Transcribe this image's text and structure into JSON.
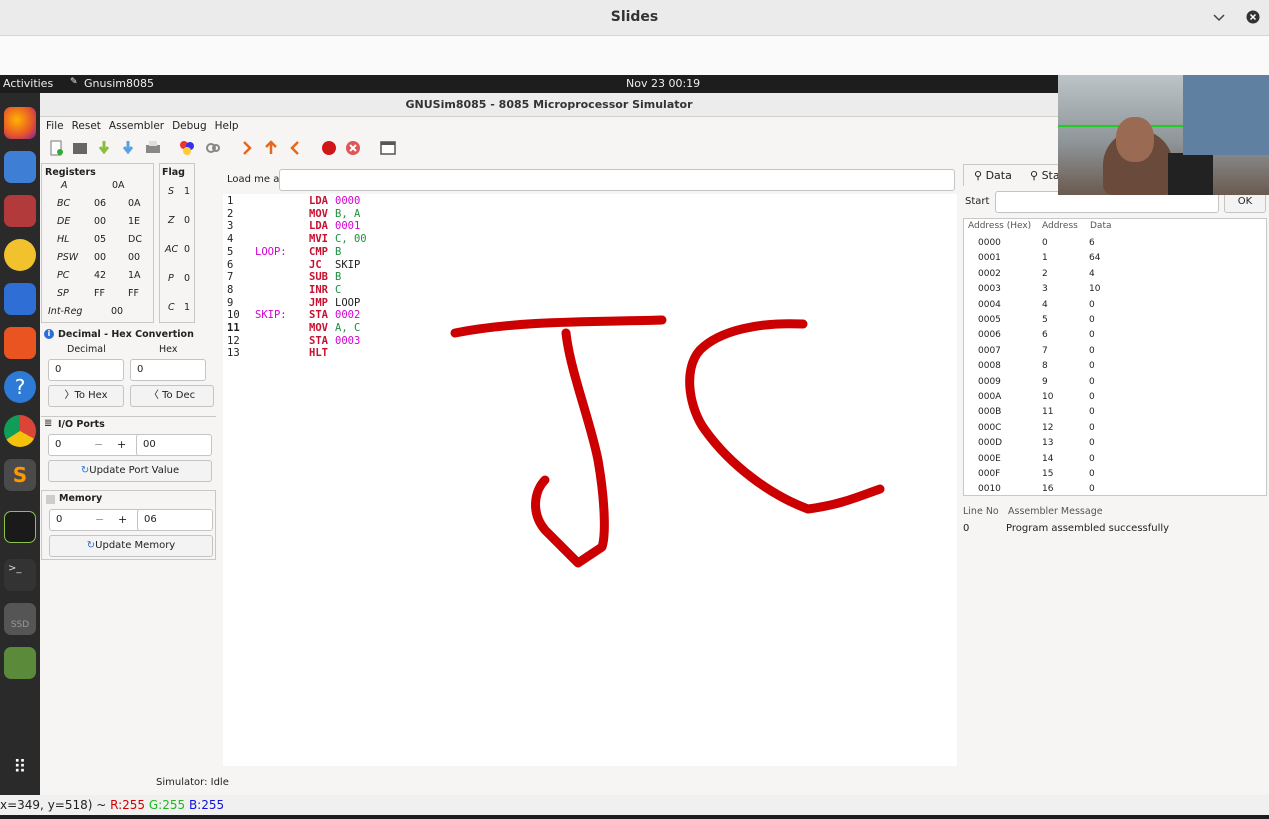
{
  "slides": {
    "title": "Slides"
  },
  "topbar": {
    "activities": "Activities",
    "app": "Gnusim8085",
    "datetime": "Nov 23  00:19"
  },
  "app": {
    "title": "GNUSim8085 - 8085 Microprocessor Simulator"
  },
  "menu": [
    "File",
    "Reset",
    "Assembler",
    "Debug",
    "Help"
  ],
  "registers": {
    "title": "Registers",
    "rows": [
      {
        "name": "A",
        "v1": "0A",
        "v2": ""
      },
      {
        "name": "BC",
        "v1": "06",
        "v2": "0A"
      },
      {
        "name": "DE",
        "v1": "00",
        "v2": "1E"
      },
      {
        "name": "HL",
        "v1": "05",
        "v2": "DC"
      },
      {
        "name": "PSW",
        "v1": "00",
        "v2": "00"
      },
      {
        "name": "PC",
        "v1": "42",
        "v2": "1A"
      },
      {
        "name": "SP",
        "v1": "FF",
        "v2": "FF"
      },
      {
        "name": "Int-Reg",
        "v1": "00",
        "v2": ""
      }
    ]
  },
  "flags": {
    "title": "Flag",
    "rows": [
      {
        "name": "S",
        "v": "1"
      },
      {
        "name": "Z",
        "v": "0"
      },
      {
        "name": "AC",
        "v": "0"
      },
      {
        "name": "P",
        "v": "0"
      },
      {
        "name": "C",
        "v": "1"
      }
    ]
  },
  "conv": {
    "title": "Decimal - Hex Convertion",
    "dec_label": "Decimal",
    "hex_label": "Hex",
    "dec_value": "0",
    "hex_value": "0",
    "to_hex": "To Hex",
    "to_dec": "To Dec"
  },
  "io": {
    "title": "I/O Ports",
    "port": "0",
    "minus": "−",
    "plus": "+",
    "value": "00",
    "update": "Update Port Value"
  },
  "memory": {
    "title": "Memory",
    "addr": "0",
    "minus": "−",
    "plus": "+",
    "value": "06",
    "update": "Update Memory"
  },
  "loadme": {
    "label": "Load me at",
    "value": ""
  },
  "code": {
    "line_numbers": [
      "1",
      "2",
      "3",
      "4",
      "5",
      "6",
      "7",
      "8",
      "9",
      "10",
      "11",
      "12",
      "13"
    ],
    "labels": [
      "",
      "",
      "",
      "",
      "LOOP:",
      "",
      "",
      "",
      "",
      "SKIP:",
      "",
      "",
      ""
    ],
    "lines": [
      {
        "op": "LDA",
        "arg": "0000"
      },
      {
        "op": "MOV",
        "arg": "B, A"
      },
      {
        "op": "LDA",
        "arg": "0001"
      },
      {
        "op": "MVI",
        "arg": "C, 00"
      },
      {
        "op": "CMP",
        "arg": "B"
      },
      {
        "op": "JC",
        "arg": "SKIP"
      },
      {
        "op": "SUB",
        "arg": "B"
      },
      {
        "op": "INR",
        "arg": "C"
      },
      {
        "op": "JMP",
        "arg": "LOOP"
      },
      {
        "op": "STA",
        "arg": "0002"
      },
      {
        "op": "MOV",
        "arg": "A, C"
      },
      {
        "op": "STA",
        "arg": "0003"
      },
      {
        "op": "HLT",
        "arg": ""
      }
    ]
  },
  "tabs": {
    "data": "Data",
    "stack": "Sta"
  },
  "data_panel": {
    "start_label": "Start",
    "start_value": "",
    "ok": "OK",
    "headers": [
      "Address (Hex)",
      "Address",
      "Data"
    ],
    "rows": [
      [
        "0000",
        "0",
        "6"
      ],
      [
        "0001",
        "1",
        "64"
      ],
      [
        "0002",
        "2",
        "4"
      ],
      [
        "0003",
        "3",
        "10"
      ],
      [
        "0004",
        "4",
        "0"
      ],
      [
        "0005",
        "5",
        "0"
      ],
      [
        "0006",
        "6",
        "0"
      ],
      [
        "0007",
        "7",
        "0"
      ],
      [
        "0008",
        "8",
        "0"
      ],
      [
        "0009",
        "9",
        "0"
      ],
      [
        "000A",
        "10",
        "0"
      ],
      [
        "000B",
        "11",
        "0"
      ],
      [
        "000C",
        "12",
        "0"
      ],
      [
        "000D",
        "13",
        "0"
      ],
      [
        "000E",
        "14",
        "0"
      ],
      [
        "000F",
        "15",
        "0"
      ],
      [
        "0010",
        "16",
        "0"
      ]
    ]
  },
  "messages": {
    "headers": [
      "Line No",
      "Assembler Message"
    ],
    "rows": [
      [
        "0",
        "Program assembled successfully"
      ]
    ]
  },
  "status": "Simulator: Idle",
  "coord": {
    "pos": "x=349, y=518) ~ ",
    "r": "R:255",
    "g": "G:255",
    "b": "B:255"
  },
  "colors": {
    "ink": "#cc0000",
    "keyword": "#c8102e",
    "number": "#d400d4",
    "register": "#1d8f3f"
  }
}
